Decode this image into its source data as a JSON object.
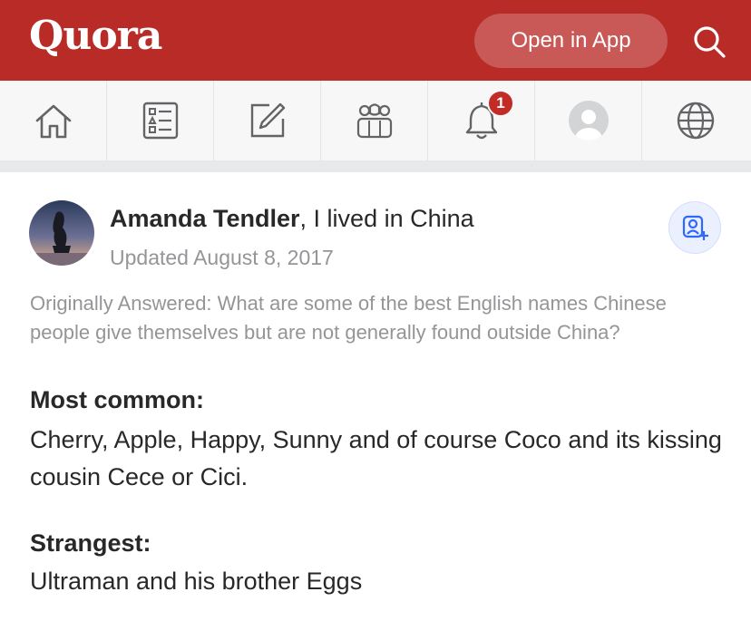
{
  "header": {
    "logo": "Quora",
    "open_in_app": "Open in App",
    "brand_color": "#b92b27"
  },
  "nav": {
    "items": [
      {
        "name": "home-icon"
      },
      {
        "name": "answer-list-icon"
      },
      {
        "name": "write-icon"
      },
      {
        "name": "spaces-icon"
      },
      {
        "name": "notifications-bell-icon",
        "badge": "1"
      },
      {
        "name": "profile-avatar-icon"
      },
      {
        "name": "globe-language-icon"
      }
    ]
  },
  "answer": {
    "author_name": "Amanda Tendler",
    "author_credential": ", I lived in China",
    "updated": "Updated August 8, 2017",
    "originally_answered": "Originally Answered: What are some of the best English names Chinese people give themselves but are not generally found outside China?",
    "section1_heading": "Most common:",
    "section1_text": "Cherry, Apple, Happy, Sunny and of course Coco and its kissing cousin Cece or Cici.",
    "section2_heading": "Strangest:",
    "section2_text": "Ultraman and his brother Eggs"
  }
}
